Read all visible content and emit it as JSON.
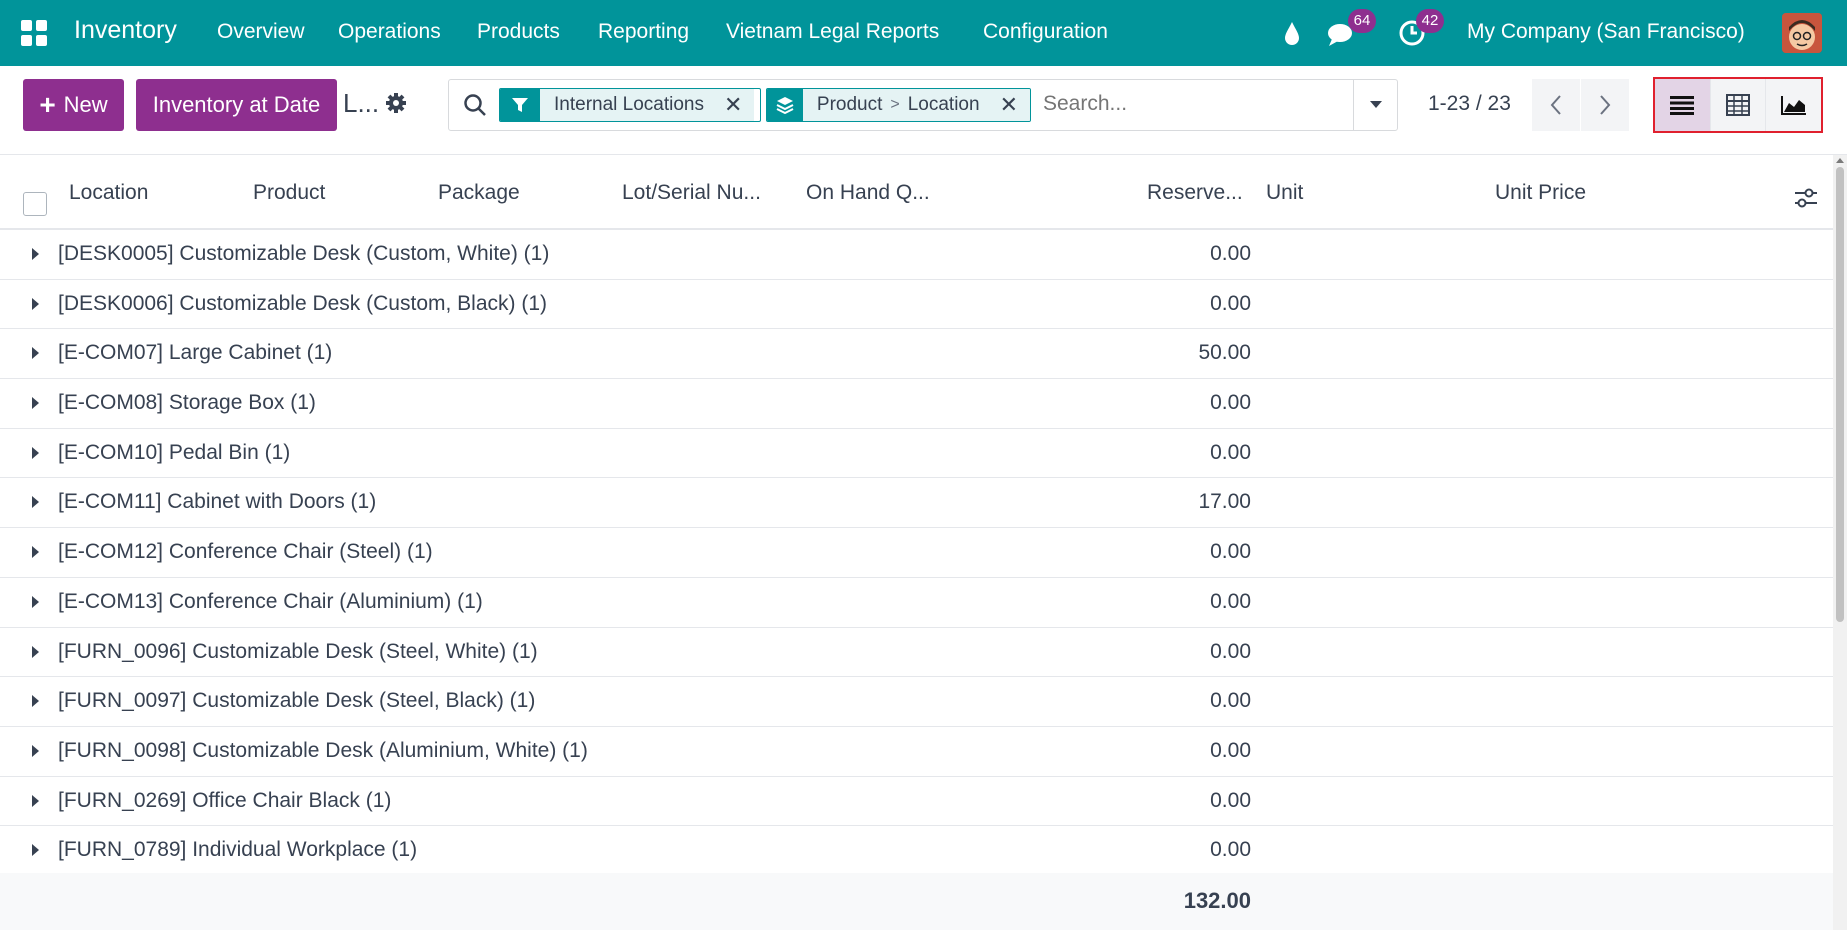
{
  "navbar": {
    "app_name": "Inventory",
    "menu": [
      "Overview",
      "Operations",
      "Products",
      "Reporting",
      "Vietnam Legal Reports",
      "Configuration"
    ],
    "messages_badge": "64",
    "activities_badge": "42",
    "company": "My Company (San Francisco)"
  },
  "control": {
    "new_label": "New",
    "inventory_at_date_label": "Inventory at Date",
    "breadcrumb": "L...",
    "search": {
      "filter_facet": "Internal Locations",
      "groupby_first": "Product",
      "groupby_separator": ">",
      "groupby_second": "Location",
      "placeholder": "Search..."
    },
    "pager": "1-23 / 23"
  },
  "table": {
    "headers": {
      "location": "Location",
      "product": "Product",
      "package": "Package",
      "lot": "Lot/Serial Nu...",
      "onhand": "On Hand Q...",
      "reserved": "Reserve...",
      "unit": "Unit",
      "unit_price": "Unit Price"
    },
    "groups": [
      {
        "name": "[DESK0005] Customizable Desk (Custom, White) (1)",
        "reserved": "0.00"
      },
      {
        "name": "[DESK0006] Customizable Desk (Custom, Black) (1)",
        "reserved": "0.00"
      },
      {
        "name": "[E-COM07] Large Cabinet (1)",
        "reserved": "50.00"
      },
      {
        "name": "[E-COM08] Storage Box (1)",
        "reserved": "0.00"
      },
      {
        "name": "[E-COM10] Pedal Bin (1)",
        "reserved": "0.00"
      },
      {
        "name": "[E-COM11] Cabinet with Doors (1)",
        "reserved": "17.00"
      },
      {
        "name": "[E-COM12] Conference Chair (Steel) (1)",
        "reserved": "0.00"
      },
      {
        "name": "[E-COM13] Conference Chair (Aluminium) (1)",
        "reserved": "0.00"
      },
      {
        "name": "[FURN_0096] Customizable Desk (Steel, White) (1)",
        "reserved": "0.00"
      },
      {
        "name": "[FURN_0097] Customizable Desk (Steel, Black) (1)",
        "reserved": "0.00"
      },
      {
        "name": "[FURN_0098] Customizable Desk (Aluminium, White) (1)",
        "reserved": "0.00"
      },
      {
        "name": "[FURN_0269] Office Chair Black (1)",
        "reserved": "0.00"
      },
      {
        "name": "[FURN_0789] Individual Workplace (1)",
        "reserved": "0.00"
      }
    ],
    "total_reserved": "132.00"
  },
  "colors": {
    "navbar": "#01949a",
    "primary_button": "#8e2f8f",
    "view_highlight_border": "#e0202e"
  }
}
